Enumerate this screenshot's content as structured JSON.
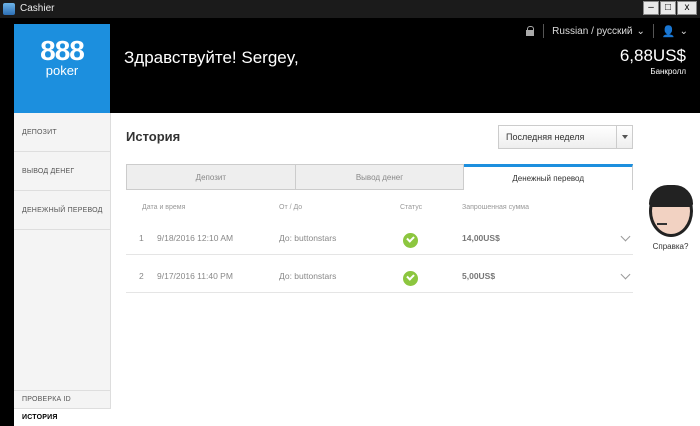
{
  "window": {
    "title": "Cashier",
    "min_label": "–",
    "max_label": "□",
    "close_label": "x"
  },
  "logo": {
    "top": "888",
    "bottom": "poker"
  },
  "header": {
    "greeting": "Здравствуйте! Sergey,",
    "language": "Russian / русский",
    "balance": "6,88US$",
    "balance_label": "Банкролл"
  },
  "sidebar": {
    "items": [
      "Депозит",
      "Вывод денег",
      "Денежный перевод"
    ],
    "bottom_items": [
      "Проверка ID",
      "История"
    ]
  },
  "main": {
    "title": "История",
    "period": "Последняя неделя",
    "tabs": [
      "Депозит",
      "Вывод денег",
      "Денежный перевод"
    ],
    "columns": {
      "date": "Дата и время",
      "from_to": "От / До",
      "status": "Статус",
      "amount": "Запрошенная сумма"
    },
    "rows": [
      {
        "num": "1",
        "date": "9/18/2016 12:10 AM",
        "from_to": "До: buttonstars",
        "amount": "14,00US$"
      },
      {
        "num": "2",
        "date": "9/17/2016 11:40 PM",
        "from_to": "До: buttonstars",
        "amount": "5,00US$"
      }
    ]
  },
  "help": {
    "label": "Справка?"
  },
  "colors": {
    "brand": "#1c8fde",
    "status_ok": "#8cc63f"
  }
}
